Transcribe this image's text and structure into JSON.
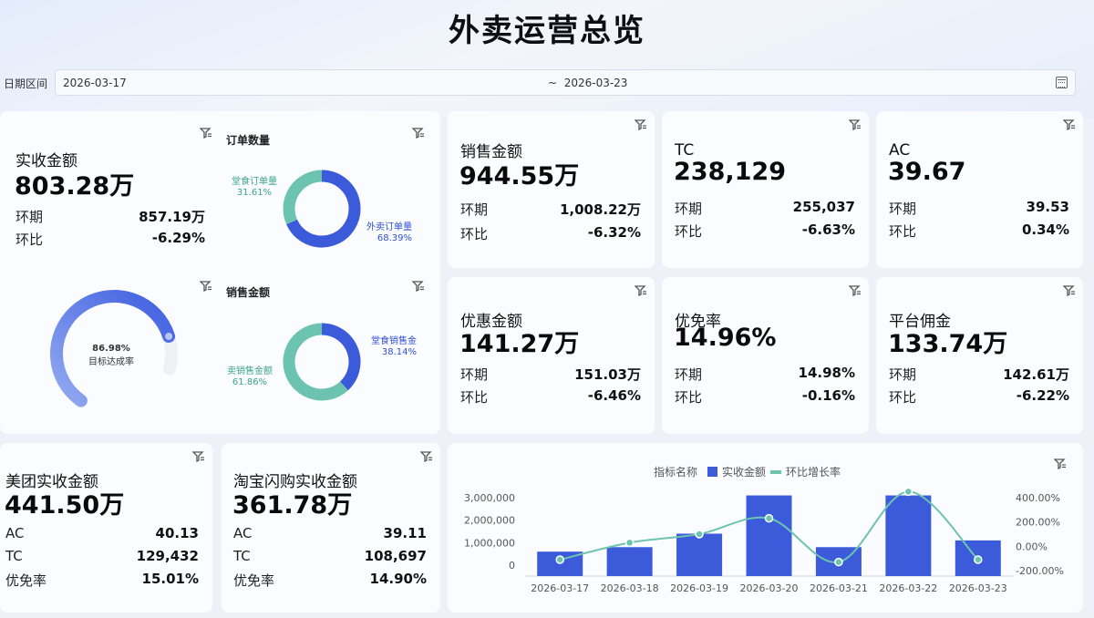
{
  "page": {
    "title": "外卖运营总览"
  },
  "date_filter": {
    "label": "日期区间",
    "start": "2026-03-17",
    "separator": "~",
    "end": "2026-03-23"
  },
  "icons": {
    "filter": "filter-icon",
    "calendar": "calendar-icon"
  },
  "colors": {
    "primary": "#3b5bdb",
    "secondary": "#6cc4b0",
    "gauge_light": "#8ea7ee"
  },
  "main_card": {
    "name": "实收金额",
    "value": "803.28万",
    "prev_label": "环期",
    "prev_value": "857.19万",
    "ratio_label": "环比",
    "ratio_value": "-6.29%"
  },
  "gauge": {
    "value_text": "86.98%",
    "label": "目标达成率",
    "fraction": 0.8698
  },
  "orders_donut": {
    "title": "订单数量",
    "slices": [
      {
        "name": "外卖订单量",
        "pct_text": "68.39%",
        "pct": 68.39
      },
      {
        "name": "堂食订单量",
        "pct_text": "31.61%",
        "pct": 31.61
      }
    ]
  },
  "sales_donut": {
    "title": "销售金额",
    "slices": [
      {
        "name": "堂食销售金",
        "pct_text": "38.14%",
        "pct": 38.14
      },
      {
        "name": "卖销售金额",
        "pct_text": "61.86%",
        "pct": 61.86
      }
    ]
  },
  "kpis": [
    {
      "name": "销售金额",
      "value": "944.55万",
      "l1": "环期",
      "v1": "1,008.22万",
      "l2": "环比",
      "v2": "-6.32%"
    },
    {
      "name": "TC",
      "value": "238,129",
      "l1": "环期",
      "v1": "255,037",
      "l2": "环比",
      "v2": "-6.63%"
    },
    {
      "name": "AC",
      "value": "39.67",
      "l1": "环期",
      "v1": "39.53",
      "l2": "环比",
      "v2": "0.34%"
    },
    {
      "name": "优惠金额",
      "value": "141.27万",
      "l1": "环期",
      "v1": "151.03万",
      "l2": "环比",
      "v2": "-6.46%"
    },
    {
      "name": "优免率",
      "value": "14.96%",
      "l1": "环期",
      "v1": "14.98%",
      "l2": "环比",
      "v2": "-0.16%"
    },
    {
      "name": "平台佣金",
      "value": "133.74万",
      "l1": "环期",
      "v1": "142.61万",
      "l2": "环比",
      "v2": "-6.22%"
    }
  ],
  "platforms": [
    {
      "name": "美团实收金额",
      "value": "441.50万",
      "l1": "AC",
      "v1": "40.13",
      "l2": "TC",
      "v2": "129,432",
      "l3": "优免率",
      "v3": "15.01%"
    },
    {
      "name": "淘宝闪购实收金额",
      "value": "361.78万",
      "l1": "AC",
      "v1": "39.11",
      "l2": "TC",
      "v2": "108,697",
      "l3": "优免率",
      "v3": "14.90%"
    }
  ],
  "chart_data": {
    "type": "bar",
    "legend_title": "指标名称",
    "categories": [
      "2026-03-17",
      "2026-03-18",
      "2026-03-19",
      "2026-03-20",
      "2026-03-21",
      "2026-03-22",
      "2026-03-23"
    ],
    "series": [
      {
        "name": "实收金额",
        "type": "bar",
        "axis": "left",
        "values": [
          600000,
          800000,
          1400000,
          3100000,
          800000,
          3100000,
          1100000
        ]
      },
      {
        "name": "环比增长率",
        "type": "line",
        "axis": "right",
        "values": [
          -110,
          30,
          100,
          230,
          -130,
          450,
          -110
        ]
      }
    ],
    "y_left_ticks": [
      "0",
      "1,000,000",
      "2,000,000",
      "3,000,000"
    ],
    "y_left_values": [
      0,
      1000000,
      2000000,
      3000000
    ],
    "y_right_ticks": [
      "-200.00%",
      "0.00%",
      "200.00%",
      "400.00%"
    ],
    "y_right_values": [
      -200,
      0,
      200,
      400
    ],
    "grid": false,
    "legend_position": "top-center"
  }
}
